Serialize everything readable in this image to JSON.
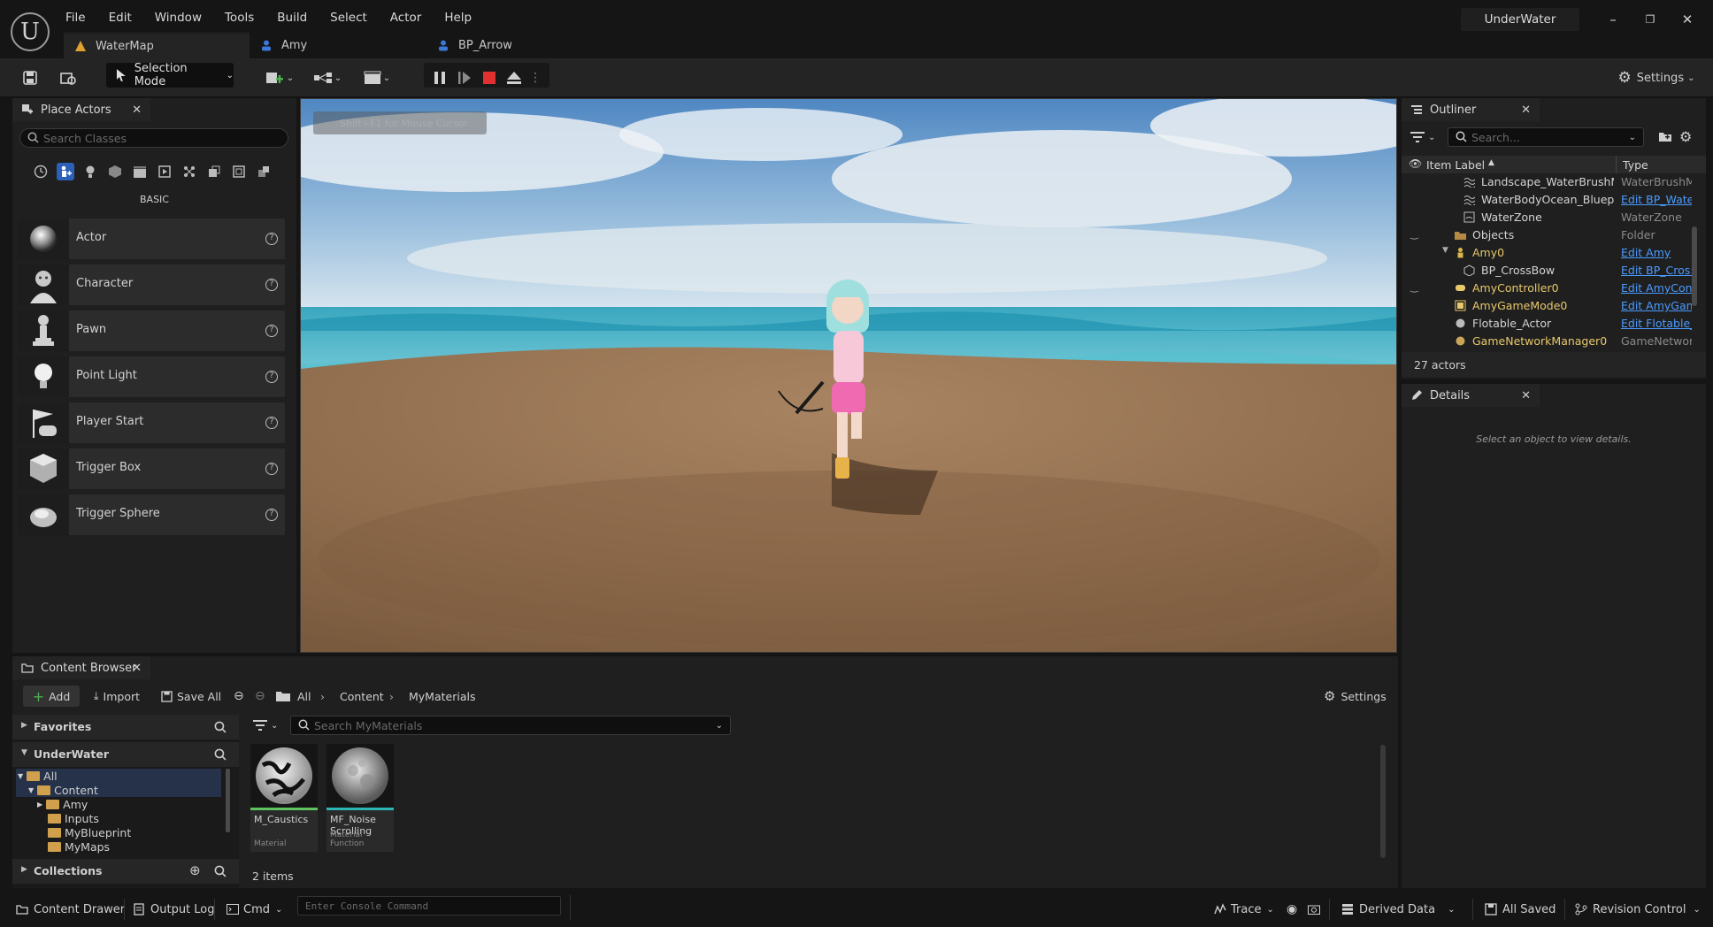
{
  "menu": [
    "File",
    "Edit",
    "Window",
    "Tools",
    "Build",
    "Select",
    "Actor",
    "Help"
  ],
  "tabs": [
    {
      "label": "WaterMap"
    },
    {
      "label": "Amy"
    },
    {
      "label": "BP_Arrow"
    }
  ],
  "project_name": "UnderWater",
  "toolbar": {
    "selection_mode": "Selection Mode",
    "settings": "Settings"
  },
  "place_actors": {
    "title": "Place Actors",
    "search_placeholder": "Search Classes",
    "category": "BASIC",
    "items": [
      "Actor",
      "Character",
      "Pawn",
      "Point Light",
      "Player Start",
      "Trigger Box",
      "Trigger Sphere"
    ]
  },
  "viewport": {
    "hint": "Shift+F1 for Mouse Cursor"
  },
  "outliner": {
    "title": "Outliner",
    "search_placeholder": "Search...",
    "col_label": "Item Label",
    "col_type": "Type",
    "rows": [
      {
        "name": "Landscape_WaterBrushM",
        "type": "WaterBrushM"
      },
      {
        "name": "WaterBodyOcean_Bluepri",
        "type": "Edit BP_Wate"
      },
      {
        "name": "WaterZone",
        "type": "WaterZone"
      },
      {
        "name": "Objects",
        "type": "Folder"
      },
      {
        "name": "Amy0",
        "type": "Edit Amy"
      },
      {
        "name": "BP_CrossBow",
        "type": "Edit BP_Cros:"
      },
      {
        "name": "AmyController0",
        "type": "Edit AmyCont"
      },
      {
        "name": "AmyGameMode0",
        "type": "Edit AmyGam"
      },
      {
        "name": "Flotable_Actor",
        "type": "Edit Flotable_"
      },
      {
        "name": "GameNetworkManager0",
        "type": "GameNetwor"
      }
    ],
    "count": "27 actors"
  },
  "details": {
    "title": "Details",
    "empty": "Select an object to view details."
  },
  "content_browser": {
    "title": "Content Browser",
    "add": "Add",
    "import": "Import",
    "save_all": "Save All",
    "path": [
      "All",
      "Content",
      "MyMaterials"
    ],
    "settings": "Settings",
    "favorites": "Favorites",
    "project": "UnderWater",
    "tree": [
      "All",
      "Content",
      "Amy",
      "Inputs",
      "MyBlueprint",
      "MyMaps"
    ],
    "collections": "Collections",
    "search_placeholder": "Search MyMaterials",
    "assets": [
      {
        "name": "M_Caustics",
        "type": "Material",
        "color": "#5ec45e"
      },
      {
        "name": "MF_Noise Scrolling",
        "type": "Material Function",
        "color": "#2bb5b5"
      }
    ],
    "count": "2 items"
  },
  "status": {
    "content_drawer": "Content Drawer",
    "output_log": "Output Log",
    "cmd": "Cmd",
    "console_placeholder": "Enter Console Command",
    "trace": "Trace",
    "derived_data": "Derived Data",
    "all_saved": "All Saved",
    "revision_control": "Revision Control"
  }
}
